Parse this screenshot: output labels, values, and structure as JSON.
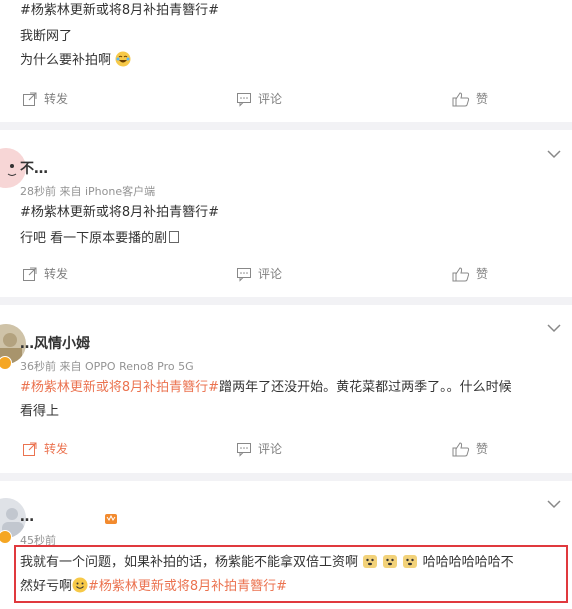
{
  "posts": [
    {
      "hashtag": "#杨紫林更新或将8月补拍青簪行#",
      "lines": [
        "我断网了",
        "为什么要补拍啊"
      ],
      "actions": {
        "repost": "转发",
        "comment": "评论",
        "like": "赞"
      }
    },
    {
      "username": "不…",
      "meta": "28秒前 来自 iPhone客户端",
      "hashtag": "#杨紫林更新或将8月补拍青簪行#",
      "text": "行吧 看一下原本要播的剧",
      "actions": {
        "repost": "转发",
        "comment": "评论",
        "like": "赞"
      }
    },
    {
      "username": "…风情小姆",
      "meta": "36秒前 来自 OPPO Reno8 Pro 5G",
      "hashtag": "#杨紫林更新或将8月补拍青簪行#",
      "text_after_hashtag": "蹭两年了还没开始。黄花菜都过两季了。。什么时候",
      "text_line2": "看得上",
      "actions": {
        "repost": "转发",
        "comment": "评论",
        "like": "赞"
      }
    },
    {
      "username": "…",
      "meta": "45秒前",
      "text_line1": "我就有一个问题，如果补拍的话，杨紫能不能拿双倍工资啊",
      "text_line1_tail": "哈哈哈哈哈哈不",
      "text_line2": "然好亏啊",
      "hashtag": "#杨紫林更新或将8月补拍青簪行#"
    }
  ],
  "colors": {
    "hashtag": "#eb7350",
    "separator": "#f2f2f5",
    "highlight": "#e0393e"
  }
}
